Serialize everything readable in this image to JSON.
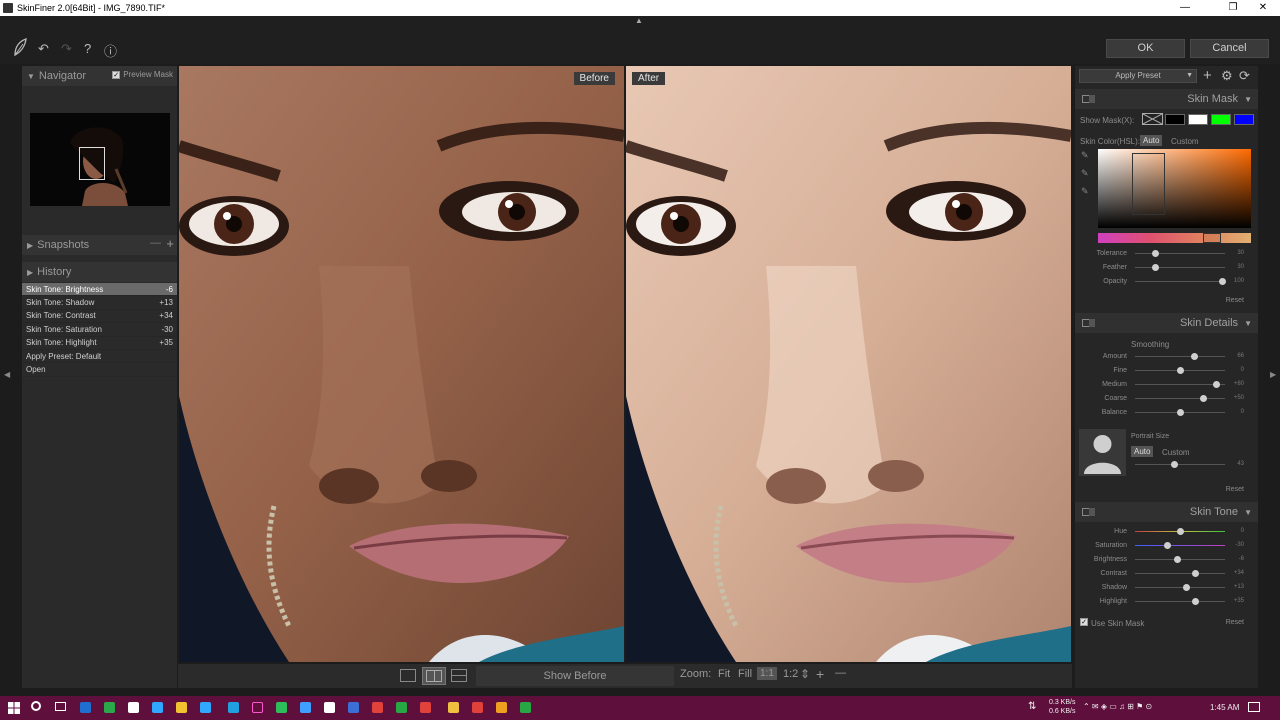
{
  "window": {
    "title": "SkinFiner 2.0[64Bit] - IMG_7890.TIF*",
    "minimize": "—",
    "maximize": "❐",
    "close": "✕"
  },
  "toolbar": {
    "logo_icon": "leaf-icon",
    "undo_icon": "↶",
    "redo_icon": "↷",
    "help_icon": "?",
    "info_icon": "ⓘ",
    "ok_label": "OK",
    "cancel_label": "Cancel",
    "collapse_icon": "▲"
  },
  "left": {
    "navigator": {
      "title": "Navigator",
      "preview_mask_label": "Preview Mask",
      "preview_mask_checked": true
    },
    "snapshots": {
      "title": "Snapshots",
      "minus": "—",
      "plus": "+"
    },
    "history": {
      "title": "History",
      "items": [
        {
          "label": "Skin Tone: Brightness",
          "value": "-6"
        },
        {
          "label": "Skin Tone: Shadow",
          "value": "+13"
        },
        {
          "label": "Skin Tone: Contrast",
          "value": "+34"
        },
        {
          "label": "Skin Tone: Saturation",
          "value": "-30"
        },
        {
          "label": "Skin Tone: Highlight",
          "value": "+35"
        },
        {
          "label": "Apply Preset: Default",
          "value": ""
        },
        {
          "label": "Open",
          "value": ""
        }
      ]
    }
  },
  "view": {
    "before_label": "Before",
    "after_label": "After"
  },
  "bottom": {
    "show_before": "Show Before",
    "zoom_label": "Zoom:",
    "fit": "Fit",
    "fill": "Fill",
    "one_to_one": "1:1",
    "one_to_two": "1:2",
    "stepper": "⇕",
    "plus": "+",
    "minus": "—"
  },
  "right": {
    "preset": {
      "label": "Apply Preset",
      "add_icon": "+",
      "gear_icon": "⚙",
      "refresh_icon": "⟳"
    },
    "skin_mask": {
      "title": "Skin Mask",
      "show_mask_label": "Show Mask(X):",
      "mask_colors": [
        "#000000",
        "#ffffff",
        "#00ff00",
        "#0000ff"
      ],
      "skin_color_label": "Skin Color(HSL):",
      "auto": "Auto",
      "custom": "Custom",
      "sliders": [
        {
          "label": "Tolerance",
          "value": "30",
          "pos": 0.22
        },
        {
          "label": "Feather",
          "value": "30",
          "pos": 0.22
        },
        {
          "label": "Opacity",
          "value": "100",
          "pos": 0.97
        }
      ],
      "reset": "Reset"
    },
    "skin_details": {
      "title": "Skin Details",
      "smoothing_label": "Smoothing",
      "sliders": [
        {
          "label": "Amount",
          "value": "66",
          "pos": 0.66
        },
        {
          "label": "Fine",
          "value": "0",
          "pos": 0.5
        },
        {
          "label": "Medium",
          "value": "+80",
          "pos": 0.9
        },
        {
          "label": "Coarse",
          "value": "+50",
          "pos": 0.75
        },
        {
          "label": "Balance",
          "value": "0",
          "pos": 0.5
        }
      ],
      "portrait_size_label": "Portrait Size",
      "auto": "Auto",
      "custom": "Custom",
      "portrait_value": "43",
      "portrait_pos": 0.43,
      "reset": "Reset"
    },
    "skin_tone": {
      "title": "Skin Tone",
      "sliders": [
        {
          "label": "Hue",
          "value": "0",
          "pos": 0.5
        },
        {
          "label": "Saturation",
          "value": "-30",
          "pos": 0.35
        },
        {
          "label": "Brightness",
          "value": "-6",
          "pos": 0.47
        },
        {
          "label": "Contrast",
          "value": "+34",
          "pos": 0.67
        },
        {
          "label": "Shadow",
          "value": "+13",
          "pos": 0.57
        },
        {
          "label": "Highlight",
          "value": "+35",
          "pos": 0.67
        }
      ],
      "use_skin_mask_label": "Use Skin Mask",
      "use_skin_mask_checked": true,
      "reset": "Reset"
    }
  },
  "taskbar": {
    "net_up": "0.3 KB/s",
    "net_down": "0.6 KB/s",
    "time": "1:45 AM"
  }
}
